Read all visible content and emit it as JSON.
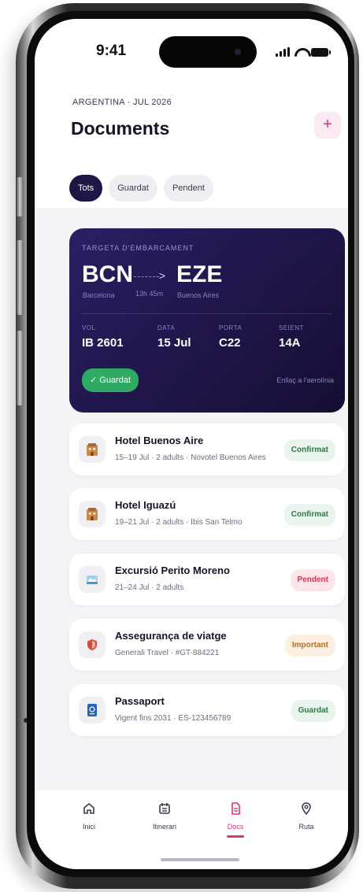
{
  "status_bar": {
    "time": "9:41"
  },
  "header": {
    "trip": "ARGENTINA · JUL 2026",
    "title": "Documents",
    "add_label": "+",
    "filters": [
      "Tots",
      "Guardat",
      "Pendent"
    ],
    "active_filter": "Tots"
  },
  "boarding_pass": {
    "label": "TARGETA D'EMBARCAMENT",
    "from_code": "BCN",
    "from_city": "Barcelona",
    "duration": "13h 45m",
    "to_code": "EZE",
    "to_city": "Buenos Aires",
    "fields": [
      {
        "label": "VOL",
        "value": "IB 2601"
      },
      {
        "label": "DATA",
        "value": "15 Jul"
      },
      {
        "label": "PORTA",
        "value": "C22"
      },
      {
        "label": "SEIENT",
        "value": "14A"
      }
    ],
    "status": "✓ Guardat",
    "link": "Enllaç a l'aerolínia"
  },
  "documents": [
    {
      "title": "Hotel Buenos Aire",
      "subtitle": "15–19 Jul · 2 adults · Novotel Buenos Aires",
      "badge": "Confirmat",
      "icon": "hotel-icon"
    },
    {
      "title": "Hotel Iguazú",
      "subtitle": "19–21 Jul · 2 adults · Ibis San Telmo",
      "badge": "Confirmat",
      "icon": "hotel-icon"
    },
    {
      "title": "Excursió Perito Moreno",
      "subtitle": "21–24 Jul · 2 adults",
      "badge": "Pendent",
      "icon": "glacier-icon"
    },
    {
      "title": "Assegurança de viatge",
      "subtitle": "Generali Travel · #GT-884221",
      "badge": "Important",
      "icon": "shield-icon"
    },
    {
      "title": "Passaport",
      "subtitle": "Vigent fins 2031 · ES-123456789",
      "badge": "Guardat",
      "icon": "passport-icon"
    }
  ],
  "nav": [
    {
      "label": "Inici",
      "icon": "home-icon"
    },
    {
      "label": "Itinerari",
      "icon": "calendar-icon"
    },
    {
      "label": "Docs",
      "icon": "document-icon"
    },
    {
      "label": "Ruta",
      "icon": "map-pin-icon"
    }
  ],
  "active_nav": "Docs",
  "colors": {
    "accent": "#e0307a",
    "navy": "#1d1746",
    "confirmed_bg": "#e8f4ec",
    "confirmed_text": "#2c7a4b",
    "pending_bg": "#fce6ea",
    "pending_text": "#d6334e",
    "important_bg": "#fdf0e1",
    "important_text": "#c46a16",
    "saved_green": "#2faa63"
  }
}
